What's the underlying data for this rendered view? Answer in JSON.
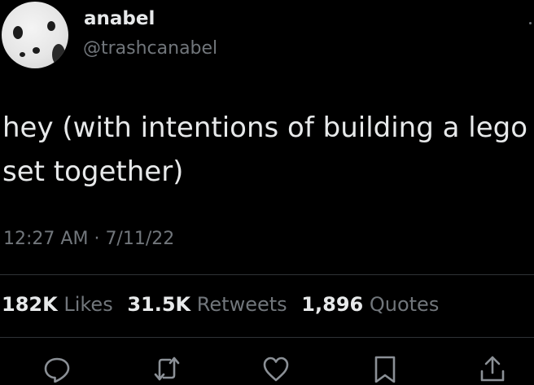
{
  "tweet": {
    "author": {
      "display_name": "anabel",
      "handle": "@trashcanabel",
      "avatar_icon": "dalmatian-avatar"
    },
    "text_lines": [
      "hey (with intentions of building a lego",
      "set together)"
    ],
    "time": "12:27 AM",
    "separator": "·",
    "date": "7/11/22",
    "stats": {
      "likes": {
        "count": "182K",
        "label": "Likes"
      },
      "retweets": {
        "count": "31.5K",
        "label": "Retweets"
      },
      "quotes": {
        "count": "1,896",
        "label": "Quotes"
      }
    },
    "actions": [
      {
        "icon": "reply-icon"
      },
      {
        "icon": "retweet-icon"
      },
      {
        "icon": "like-icon"
      },
      {
        "icon": "bookmark-icon"
      },
      {
        "icon": "share-icon"
      }
    ]
  },
  "colors": {
    "background": "#000000",
    "primary_text": "#e7e9ea",
    "secondary_text": "#71767b",
    "divider": "#2f3336"
  }
}
